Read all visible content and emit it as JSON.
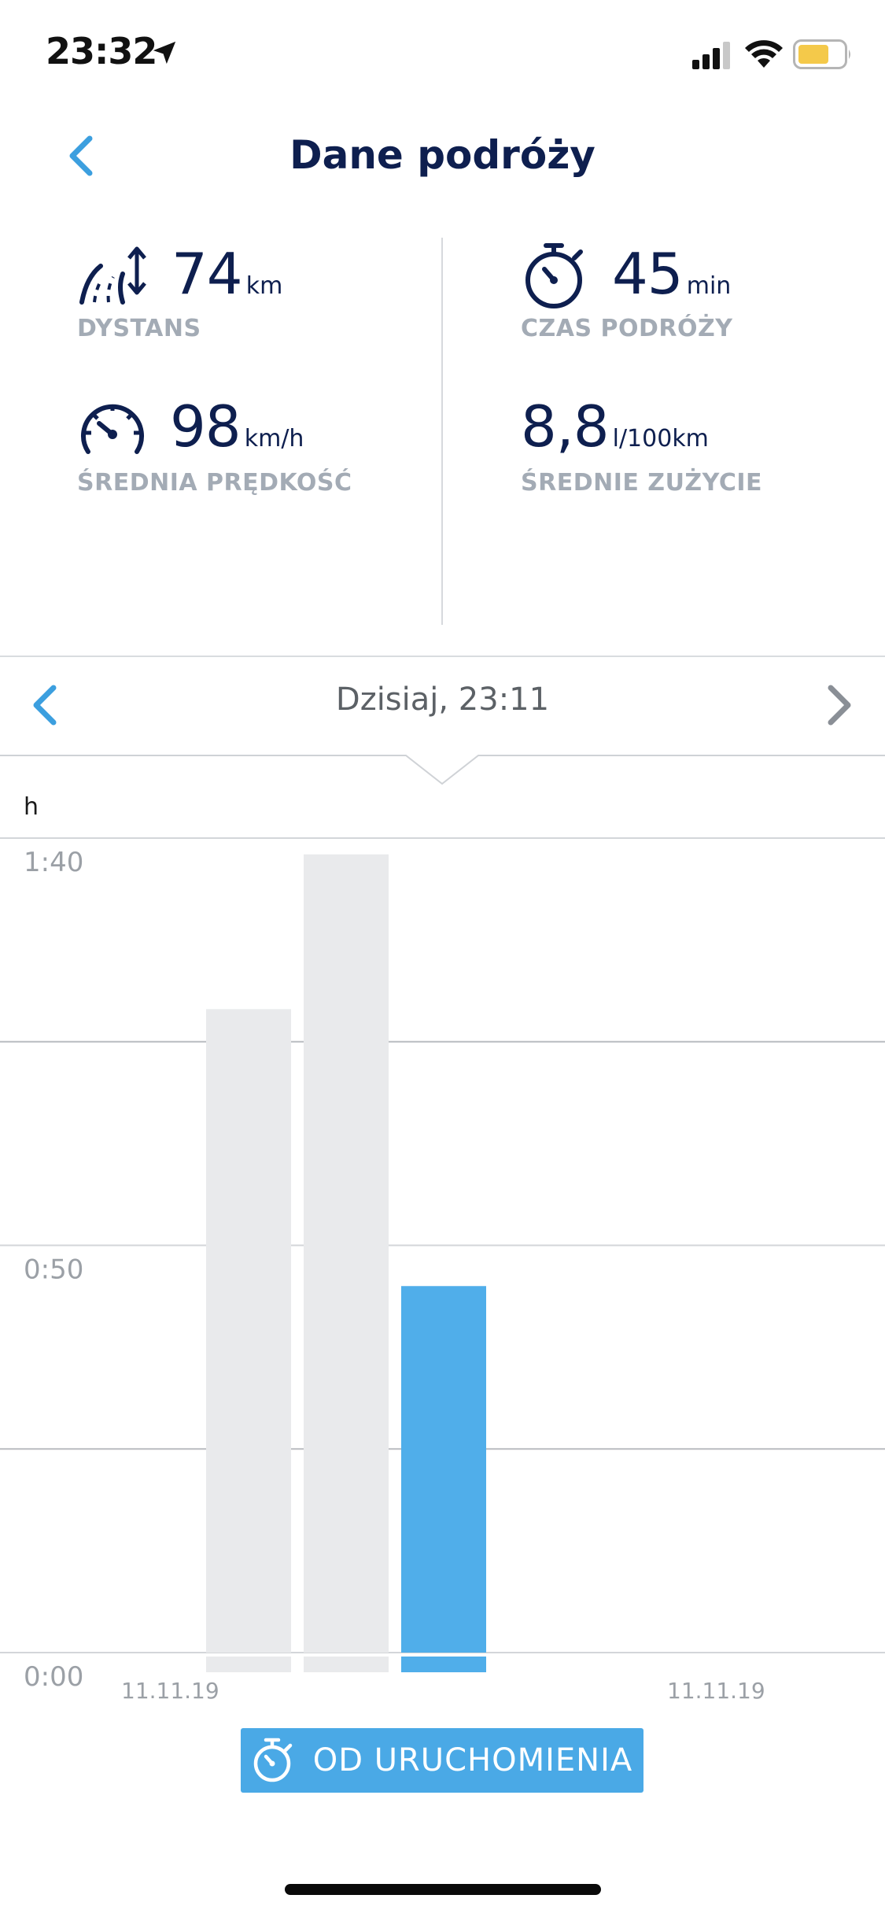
{
  "status_bar": {
    "time": "23:32",
    "icons": [
      "location-arrow-icon",
      "cellular-signal-icon",
      "wifi-icon",
      "battery-icon"
    ],
    "battery_color": "#f4c94a"
  },
  "header": {
    "title": "Dane podróży",
    "back_icon": "chevron-left-icon"
  },
  "stats": {
    "distance": {
      "value": "74",
      "unit": "km",
      "label": "DYSTANS",
      "icon": "road-distance-icon"
    },
    "travel_time": {
      "value": "45",
      "unit": "min",
      "label": "CZAS PODRÓŻY",
      "icon": "stopwatch-icon"
    },
    "avg_speed": {
      "value": "98",
      "unit": "km/h",
      "label": "ŚREDNIA PRĘDKOŚĆ",
      "icon": "speedometer-icon"
    },
    "avg_consumption": {
      "value": "8,8",
      "unit": "l/100km",
      "label": "ŚREDNIE ZUŻYCIE"
    }
  },
  "date_nav": {
    "label": "Dzisiaj, 23:11",
    "prev_icon": "chevron-left-icon",
    "next_icon": "chevron-right-icon"
  },
  "chart_data": {
    "type": "bar",
    "ylabel": "h",
    "yticks": [
      "1:40",
      "0:50",
      "0:00"
    ],
    "ylim_minutes": [
      0,
      100
    ],
    "grid": true,
    "categories": [
      "trip-1",
      "trip-2",
      "trip-3"
    ],
    "values_minutes": [
      79,
      98,
      45
    ],
    "bar_colors": [
      "#e9eaec",
      "#e9eaec",
      "#50aeea"
    ],
    "highlighted_index": 2,
    "x_date_labels": [
      "11.11.19",
      "11.11.19"
    ]
  },
  "mode_button": {
    "label": "OD URUCHOMIENIA",
    "icon": "stopwatch-icon"
  },
  "colors": {
    "accent": "#4aa9e6",
    "navy": "#0e1f4f",
    "label_gray": "#a3abb5"
  }
}
